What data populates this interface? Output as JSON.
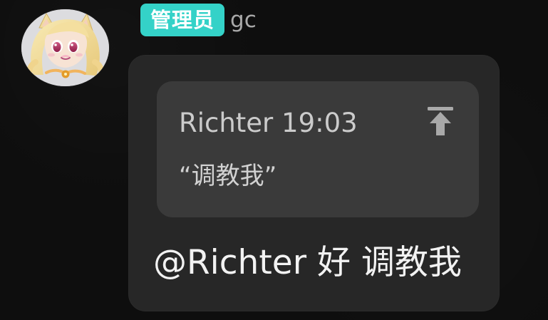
{
  "sender": {
    "role_badge": "管理员",
    "name": "gc"
  },
  "message": {
    "quote": {
      "author": "Richter",
      "time": "19:03",
      "text": "“调教我”"
    },
    "text": "@Richter 好 调教我"
  },
  "icons": {
    "avatar": "anime-avatar",
    "jump": "jump-to-quote-icon"
  },
  "colors": {
    "background": "#0e0e0e",
    "badge": "#34d2c8",
    "bubble": "#272727",
    "quote_card": "#3a3a3a",
    "secondary_text": "#a9a9a9",
    "message_text": "#f2f2f2"
  }
}
